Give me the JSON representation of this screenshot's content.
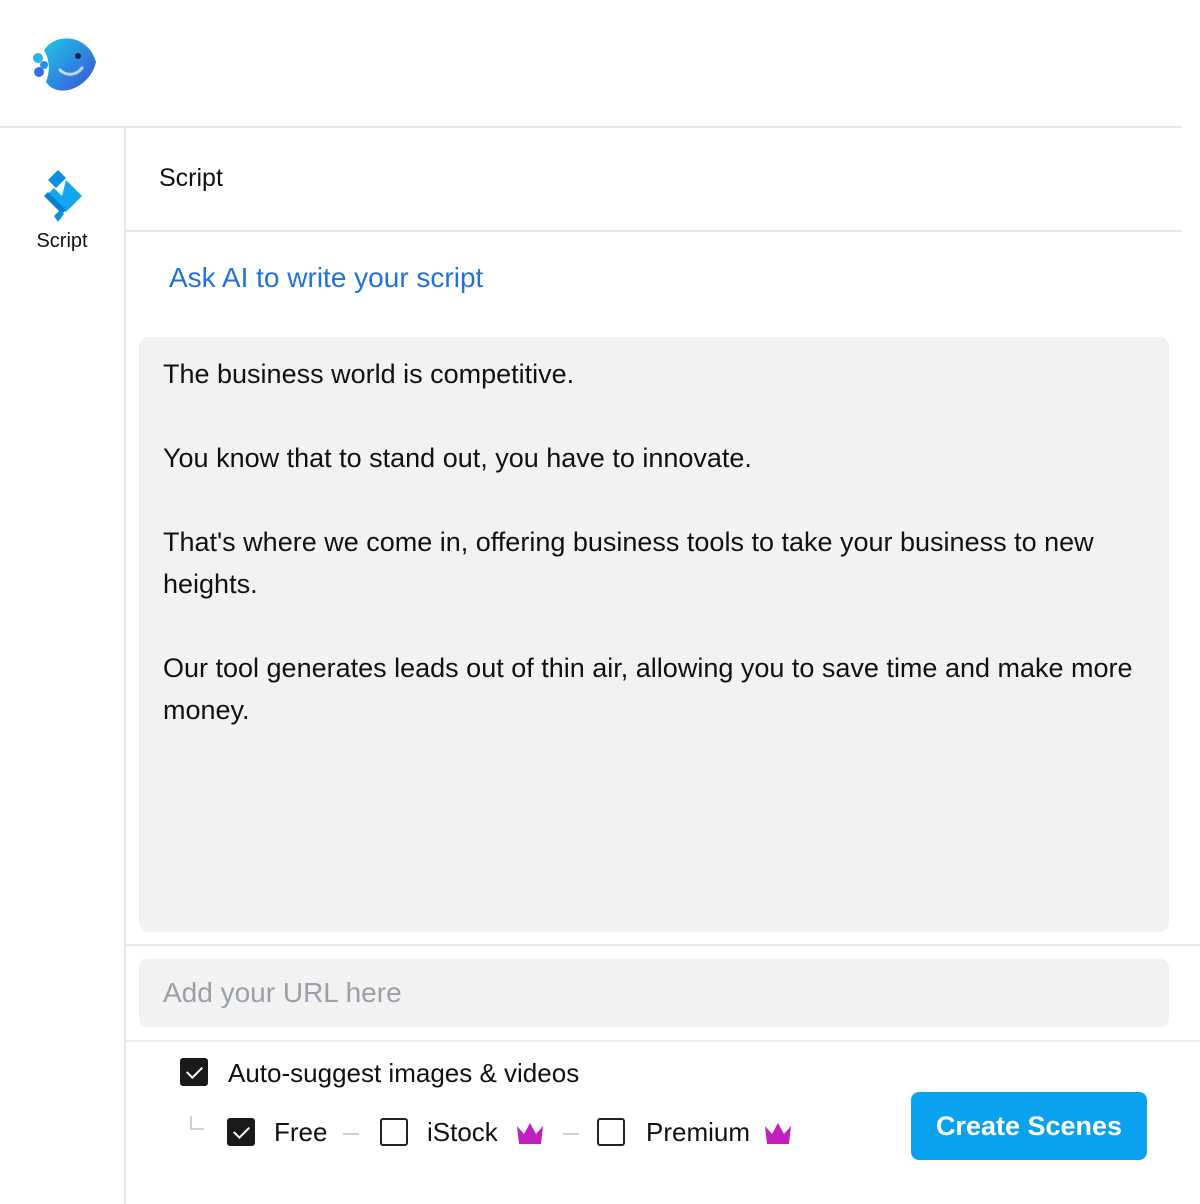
{
  "app": {
    "logo_icon": "fish-logo-icon"
  },
  "sidebar": {
    "items": [
      {
        "label": "Script",
        "icon": "script-pen-icon"
      }
    ]
  },
  "panel": {
    "title": "Script",
    "ai_link_label": "Ask AI to write your script",
    "script_paragraphs": [
      "The business world is competitive.",
      "You know that to stand out, you have to innovate.",
      "That's where we come in, offering business tools to take your business to new heights.",
      "Our tool generates leads out of thin air, allowing you to save time and make more money."
    ],
    "url_input": {
      "placeholder": "Add your URL here",
      "value": ""
    },
    "options": {
      "auto_suggest": {
        "label": "Auto-suggest images & videos",
        "checked": true
      },
      "sources": [
        {
          "label": "Free",
          "checked": true,
          "premium": false
        },
        {
          "label": "iStock",
          "checked": false,
          "premium": true,
          "icon": "crown-icon"
        },
        {
          "label": "Premium",
          "checked": false,
          "premium": true,
          "icon": "crown-icon"
        }
      ]
    },
    "create_button_label": "Create Scenes"
  },
  "colors": {
    "accent_link": "#1f73d6",
    "primary_button": "#0aa1ee",
    "crown": "#c21fc0",
    "logo_gradient": [
      "#1ec8e8",
      "#3b5bdb"
    ]
  }
}
